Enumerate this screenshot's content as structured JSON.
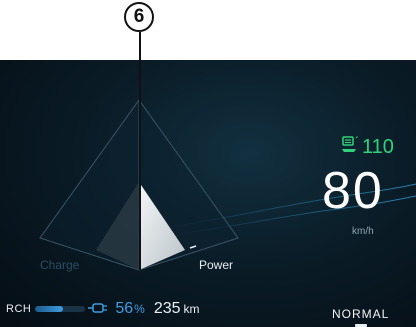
{
  "callout": {
    "number": "6"
  },
  "power_meter": {
    "charge_label": "Charge",
    "power_label": "Power",
    "power_level": 0.42
  },
  "speed_limit": {
    "value": "110",
    "icon": "speed-limit-sign-icon"
  },
  "speedometer": {
    "value": "80",
    "unit": "km/h"
  },
  "battery": {
    "mode_label": "RCH",
    "charge_percent": "56",
    "percent_sign": "%",
    "range": "235",
    "range_unit": "km",
    "fill_fraction": 0.56
  },
  "drive_mode": {
    "label": "NORMAL"
  },
  "colors": {
    "accent_blue": "#3f9ce0",
    "speed_limit_green": "#2fd37a",
    "background": "#0a1c27"
  }
}
